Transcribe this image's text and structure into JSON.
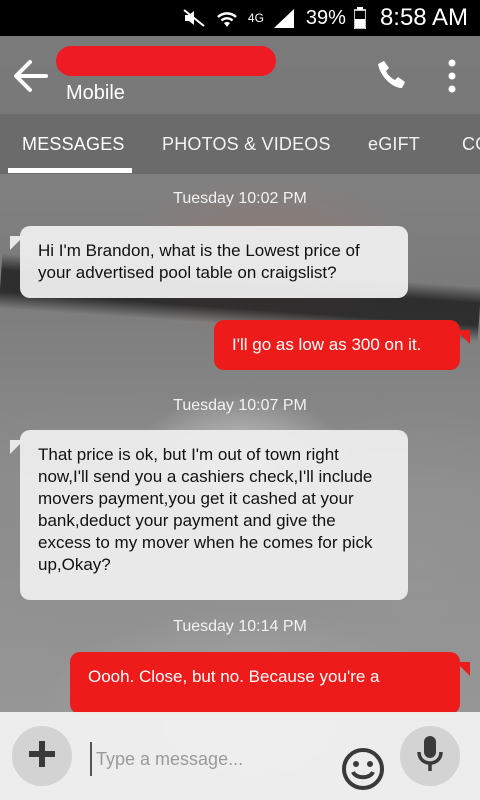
{
  "status_bar": {
    "network": "4G",
    "battery_percent": "39%",
    "time": "8:58 AM"
  },
  "header": {
    "contact_subtitle": "Mobile"
  },
  "tabs": [
    {
      "label": "MESSAGES",
      "active": true
    },
    {
      "label": "PHOTOS & VIDEOS",
      "active": false
    },
    {
      "label": "eGIFT",
      "active": false
    },
    {
      "label": "CO",
      "active": false
    }
  ],
  "messages": [
    {
      "type": "timestamp",
      "text": "Tuesday 10:02 PM"
    },
    {
      "type": "incoming",
      "text": "Hi I'm Brandon, what is the Lowest price of your advertised pool table on craigslist?"
    },
    {
      "type": "outgoing",
      "text": "I'll go as low as 300 on it."
    },
    {
      "type": "timestamp",
      "text": "Tuesday 10:07 PM"
    },
    {
      "type": "incoming",
      "text": "That price is ok, but I'm out of town right now,I'll send you a cashiers check,I'll include movers payment,you get it cashed at your bank,deduct your payment and give the excess to my mover when he comes for pick up,Okay?"
    },
    {
      "type": "timestamp",
      "text": "Tuesday 10:14 PM"
    },
    {
      "type": "outgoing",
      "text": "Oooh. Close, but no. Because you're a"
    }
  ],
  "compose": {
    "placeholder": "Type a message..."
  },
  "colors": {
    "accent_red": "#ee1b1b",
    "incoming_bubble": "#ececec"
  }
}
